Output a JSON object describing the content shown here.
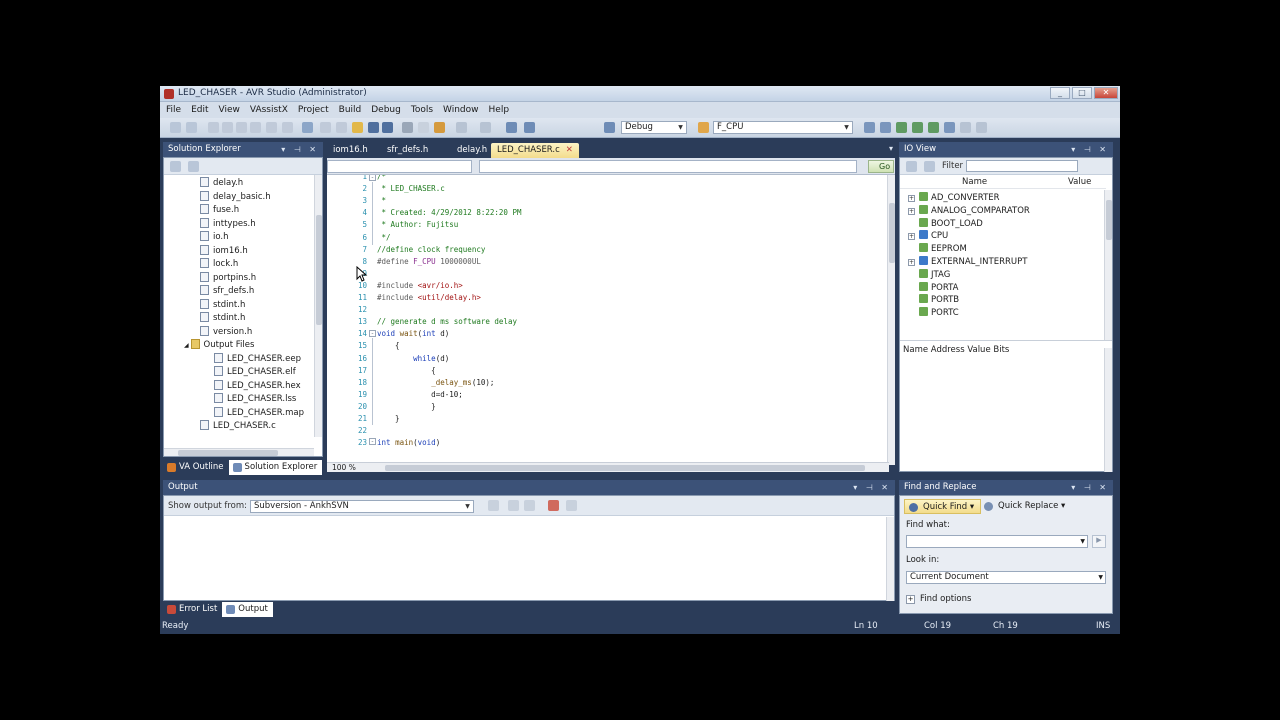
{
  "window": {
    "title": "LED_CHASER - AVR Studio (Administrator)"
  },
  "menu": [
    "File",
    "Edit",
    "View",
    "VAssistX",
    "Project",
    "Build",
    "Debug",
    "Tools",
    "Window",
    "Help"
  ],
  "toolbar": {
    "configuration": "Debug",
    "find_combo": "F_CPU"
  },
  "solution_explorer": {
    "title": "Solution Explorer",
    "items": [
      {
        "label": "delay.h",
        "type": "file"
      },
      {
        "label": "delay_basic.h",
        "type": "file"
      },
      {
        "label": "fuse.h",
        "type": "file"
      },
      {
        "label": "inttypes.h",
        "type": "file"
      },
      {
        "label": "io.h",
        "type": "file"
      },
      {
        "label": "iom16.h",
        "type": "file"
      },
      {
        "label": "lock.h",
        "type": "file"
      },
      {
        "label": "portpins.h",
        "type": "file"
      },
      {
        "label": "sfr_defs.h",
        "type": "file"
      },
      {
        "label": "stdint.h",
        "type": "file"
      },
      {
        "label": "stdint.h",
        "type": "file"
      },
      {
        "label": "version.h",
        "type": "file"
      },
      {
        "label": "Output Files",
        "type": "folder"
      },
      {
        "label": "LED_CHASER.eep",
        "type": "file"
      },
      {
        "label": "LED_CHASER.elf",
        "type": "file"
      },
      {
        "label": "LED_CHASER.hex",
        "type": "file"
      },
      {
        "label": "LED_CHASER.lss",
        "type": "file"
      },
      {
        "label": "LED_CHASER.map",
        "type": "file"
      },
      {
        "label": "LED_CHASER.c",
        "type": "file"
      }
    ],
    "tabs": [
      "VA Outline",
      "Solution Explorer"
    ]
  },
  "editor": {
    "tabs": [
      "iom16.h",
      "sfr_defs.h",
      "delay.h",
      "LED_CHASER.c"
    ],
    "active_tab": "LED_CHASER.c",
    "go_label": "Go",
    "zoom": "100 %",
    "lines": [
      {
        "n": "1",
        "html": "<span class='c-cm'>/*</span>"
      },
      {
        "n": "2",
        "html": "<span class='c-cm'> * LED_CHASER.c</span>"
      },
      {
        "n": "3",
        "html": "<span class='c-cm'> *</span>"
      },
      {
        "n": "4",
        "html": "<span class='c-cm'> * Created: 4/29/2012 8:22:20 PM</span>"
      },
      {
        "n": "5",
        "html": "<span class='c-cm'> * Author: Fujitsu</span>"
      },
      {
        "n": "6",
        "html": "<span class='c-cm'> */</span>"
      },
      {
        "n": "7",
        "html": "<span class='c-cm'>//define clock frequency</span>"
      },
      {
        "n": "8",
        "html": "<span class='c-pp'>#define</span> <span class='c-mac'>F_CPU</span> <span class='c-pp'>1000000UL</span>"
      },
      {
        "n": "9",
        "html": ""
      },
      {
        "n": "10",
        "html": "<span class='c-pp'>#include</span> <span class='c-str'>&lt;avr/io.h&gt;</span>"
      },
      {
        "n": "11",
        "html": "<span class='c-pp'>#include</span> <span class='c-str'>&lt;util/delay.h&gt;</span>"
      },
      {
        "n": "12",
        "html": ""
      },
      {
        "n": "13",
        "html": "<span class='c-cm'>// generate d ms software delay</span>"
      },
      {
        "n": "14",
        "html": "<span class='c-kw'>void</span> <span class='c-fn'>wait</span>(<span class='c-kw'>int</span> d)"
      },
      {
        "n": "15",
        "html": "    {"
      },
      {
        "n": "16",
        "html": "        <span class='c-kw'>while</span>(d)"
      },
      {
        "n": "17",
        "html": "            {"
      },
      {
        "n": "18",
        "html": "            <span class='c-fn'>_delay_ms</span>(10);"
      },
      {
        "n": "19",
        "html": "            d=d-10;"
      },
      {
        "n": "20",
        "html": "            }"
      },
      {
        "n": "21",
        "html": "    }"
      },
      {
        "n": "22",
        "html": ""
      },
      {
        "n": "23",
        "html": "<span class='c-kw'>int</span> <span class='c-fn'>main</span>(<span class='c-kw'>void</span>)"
      }
    ]
  },
  "io_view": {
    "title": "IO View",
    "filter_label": "Filter",
    "columns": [
      "Name",
      "Value"
    ],
    "items": [
      {
        "label": "AD_CONVERTER",
        "expandable": true
      },
      {
        "label": "ANALOG_COMPARATOR",
        "expandable": true
      },
      {
        "label": "BOOT_LOAD",
        "expandable": false
      },
      {
        "label": "CPU",
        "expandable": true
      },
      {
        "label": "EEPROM",
        "expandable": false
      },
      {
        "label": "EXTERNAL_INTERRUPT",
        "expandable": true
      },
      {
        "label": "JTAG",
        "expandable": false
      },
      {
        "label": "PORTA",
        "expandable": false
      },
      {
        "label": "PORTB",
        "expandable": false
      },
      {
        "label": "PORTC",
        "expandable": false
      }
    ],
    "detail_header": "Name Address Value Bits"
  },
  "output": {
    "title": "Output",
    "show_from_label": "Show output from:",
    "source": "Subversion - AnkhSVN",
    "tabs": [
      "Error List",
      "Output"
    ]
  },
  "find_replace": {
    "title": "Find and Replace",
    "quick_find": "Quick Find",
    "quick_replace": "Quick Replace",
    "find_what_label": "Find what:",
    "look_in_label": "Look in:",
    "look_in_value": "Current Document",
    "find_options": "Find options"
  },
  "status": {
    "state": "Ready",
    "ln": "Ln 10",
    "col": "Col 19",
    "ch": "Ch 19",
    "mode": "INS"
  }
}
